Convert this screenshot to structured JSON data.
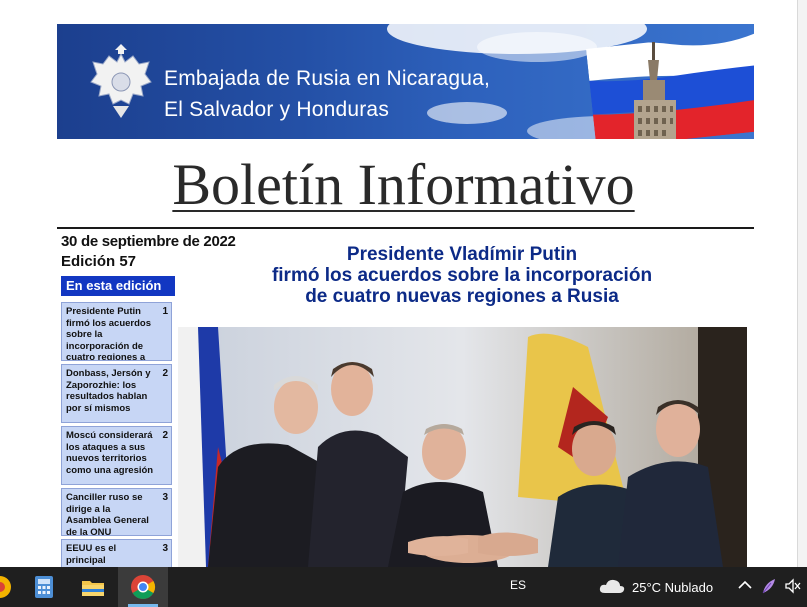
{
  "banner": {
    "line1": "Embajada de Rusia en Nicaragua,",
    "line2": "El Salvador y Honduras"
  },
  "masthead": "Boletín Informativo",
  "issue": {
    "date": "30 de septiembre de 2022",
    "edition": "Edición 57"
  },
  "toc": {
    "heading": "En esta edición",
    "items": [
      {
        "text": "Presidente Putin firmó los acuerdos sobre la incorporación de cuatro regiones a Rusia",
        "page": "1"
      },
      {
        "text": "Donbass, Jersón y Zaporozhie: los resultados hablan por sí mismos",
        "page": "2"
      },
      {
        "text": "Moscú considerará los ataques a sus nuevos territorios como una agresión",
        "page": "2"
      },
      {
        "text": "Canciller ruso se dirige a la Asamblea General de la ONU",
        "page": "3"
      },
      {
        "text": "EEUU es el principal beneficiario del sabotaje al Nord",
        "page": "3"
      }
    ]
  },
  "headline": {
    "line1": "Presidente Vladímir Putin",
    "line2": "firmó los acuerdos sobre la incorporación",
    "line3": "de cuatro nuevas regiones a Rusia"
  },
  "taskbar": {
    "language": "ES",
    "weather": "25°C  Nublado"
  },
  "colors": {
    "banner_blue": "#2450a6",
    "headline_blue": "#0c2a87",
    "toc_heading_bg": "#1237c2",
    "toc_item_bg": "#c7d6f5"
  }
}
